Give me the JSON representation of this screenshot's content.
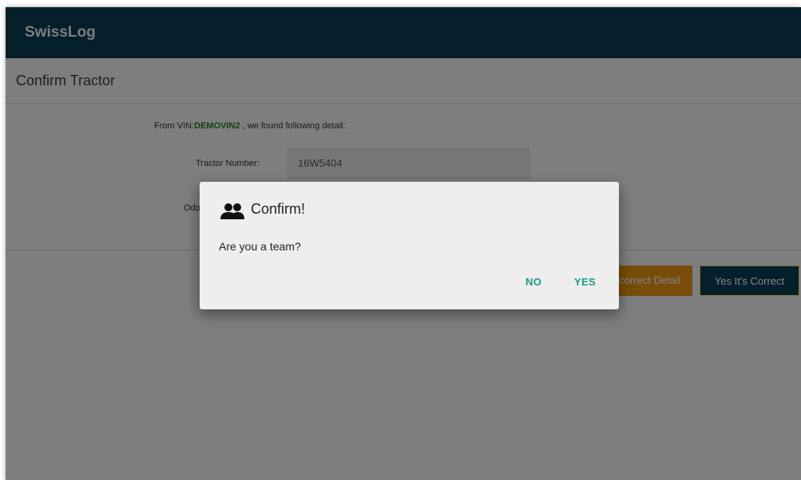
{
  "app": {
    "title": "SwissLog",
    "header_color": "#083a52"
  },
  "page": {
    "title": "Confirm Tractor"
  },
  "detail": {
    "vin_prefix": "From VIN:",
    "vin": "DEMOVIN2",
    "vin_suffix": " , we found following detail:",
    "tractor_label": "Tractor Number:",
    "tractor_value": "16W5404",
    "odometer_label_partial": "Odo"
  },
  "actions": {
    "incorrect_label": "Incorrect Detail",
    "correct_label": "Yes It's Correct",
    "incorrect_color": "#e69512",
    "correct_color": "#0a3f57"
  },
  "dialog": {
    "icon": "group-icon",
    "title": "Confirm!",
    "message": "Are you a team?",
    "no_label": "NO",
    "yes_label": "YES",
    "button_color": "#1a9a86"
  }
}
